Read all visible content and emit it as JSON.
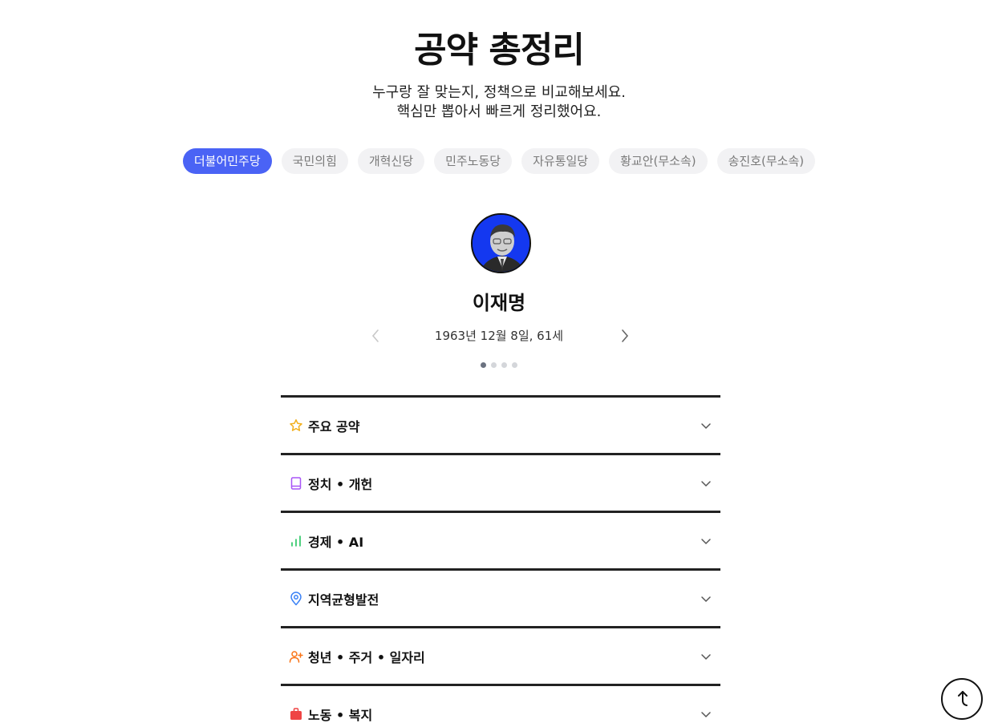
{
  "header": {
    "title": "공약 총정리",
    "subtitle_line1": "누구랑 잘 맞는지, 정책으로 비교해보세요.",
    "subtitle_line2": "핵심만 뽑아서 빠르게 정리했어요."
  },
  "parties": [
    {
      "label": "더불어민주당",
      "active": true
    },
    {
      "label": "국민의힘",
      "active": false
    },
    {
      "label": "개혁신당",
      "active": false
    },
    {
      "label": "민주노동당",
      "active": false
    },
    {
      "label": "자유통일당",
      "active": false
    },
    {
      "label": "황교안(무소속)",
      "active": false
    },
    {
      "label": "송진호(무소속)",
      "active": false
    }
  ],
  "candidate": {
    "name": "이재명",
    "info": "1963년 12월 8일, 61세",
    "avatar_bg": "#1438f0"
  },
  "carousel": {
    "total": 4,
    "current": 1
  },
  "sections": [
    {
      "label": "주요 공약",
      "icon": "star-icon",
      "color": "#f2b01e"
    },
    {
      "label": "정치 • 개헌",
      "icon": "book-icon",
      "color": "#a855f7"
    },
    {
      "label": "경제 • AI",
      "icon": "bar-chart-icon",
      "color": "#22c55e"
    },
    {
      "label": "지역균형발전",
      "icon": "map-pin-icon",
      "color": "#3b82f6"
    },
    {
      "label": "청년 • 주거 • 일자리",
      "icon": "user-plus-icon",
      "color": "#f97316"
    },
    {
      "label": "노동 • 복지",
      "icon": "briefcase-icon",
      "color": "#ef4444"
    }
  ],
  "colors": {
    "accent": "#4a63f5"
  }
}
